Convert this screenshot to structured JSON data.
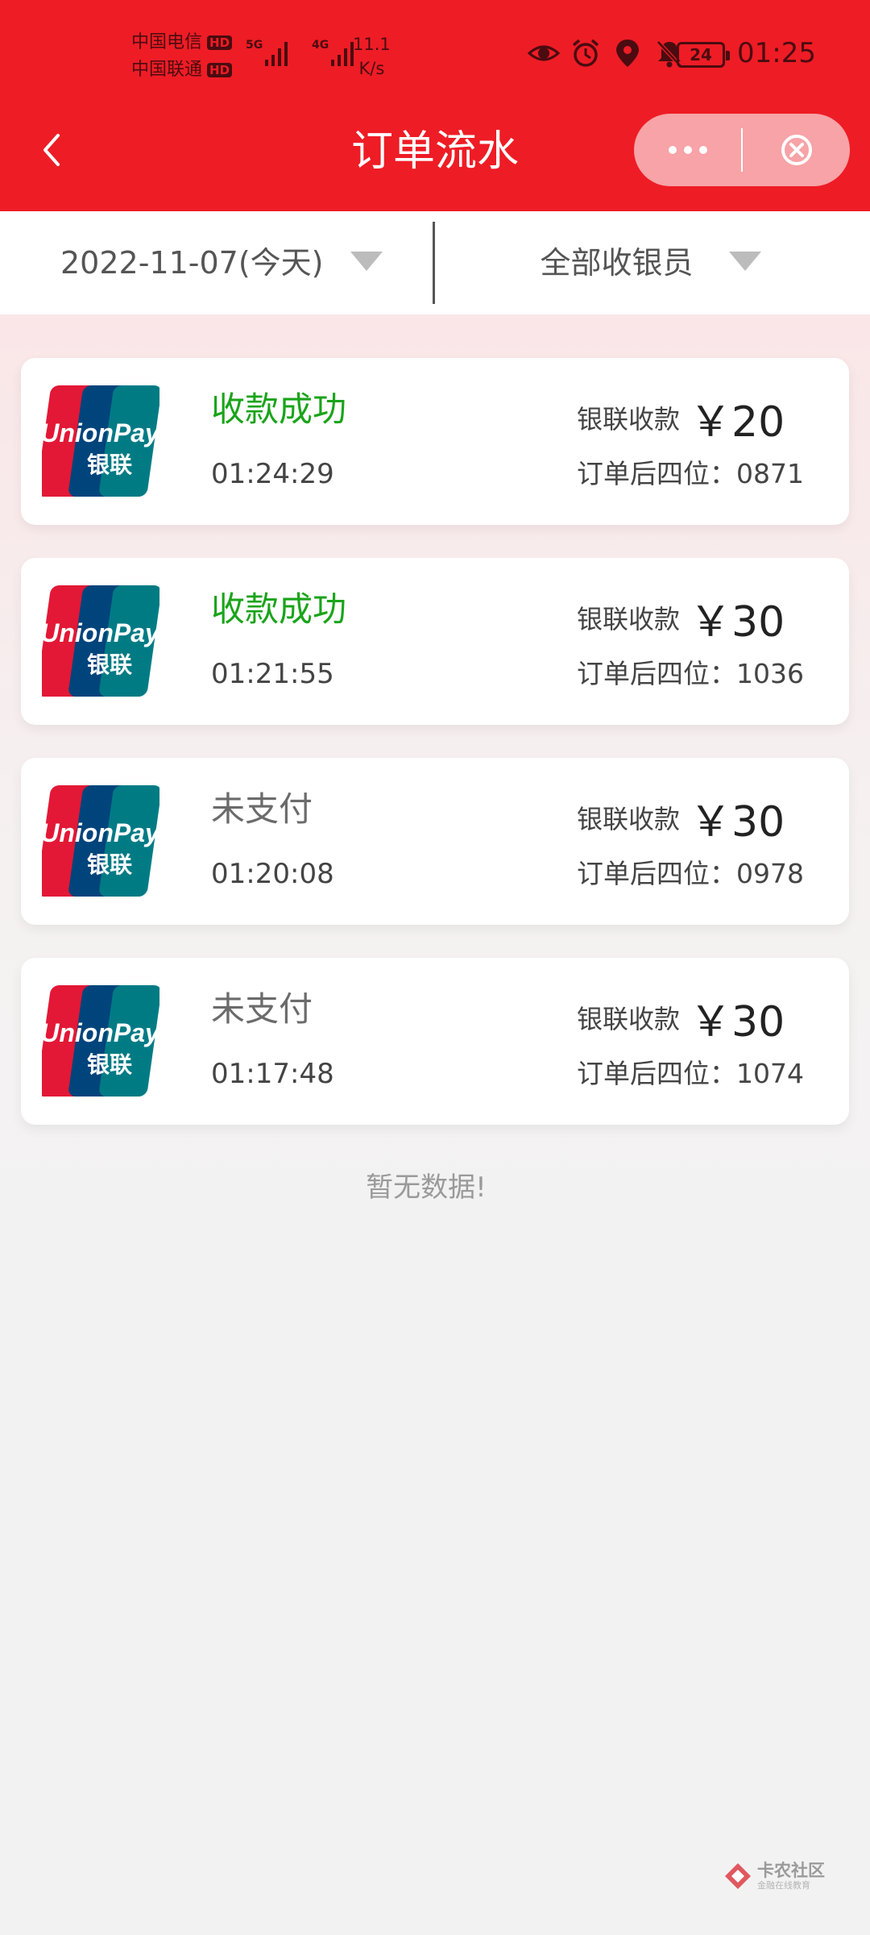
{
  "status_bar": {
    "carriers": [
      "中国电信",
      "中国联通"
    ],
    "hd_badge": "HD",
    "networks": [
      "5G",
      "4G"
    ],
    "speed_value": "11.1",
    "speed_unit": "K/s",
    "battery": "24",
    "time": "01:25"
  },
  "header": {
    "title": "订单流水"
  },
  "filters": {
    "date": "2022-11-07(今天)",
    "cashier": "全部收银员"
  },
  "orders": [
    {
      "status": "收款成功",
      "status_type": "success",
      "time": "01:24:29",
      "pay_label": "银联收款",
      "amount": "￥20",
      "order_label": "订单后四位：",
      "order_suffix": "0871"
    },
    {
      "status": "收款成功",
      "status_type": "success",
      "time": "01:21:55",
      "pay_label": "银联收款",
      "amount": "￥30",
      "order_label": "订单后四位：",
      "order_suffix": "1036"
    },
    {
      "status": "未支付",
      "status_type": "unpaid",
      "time": "01:20:08",
      "pay_label": "银联收款",
      "amount": "￥30",
      "order_label": "订单后四位：",
      "order_suffix": "0978"
    },
    {
      "status": "未支付",
      "status_type": "unpaid",
      "time": "01:17:48",
      "pay_label": "银联收款",
      "amount": "￥30",
      "order_label": "订单后四位：",
      "order_suffix": "1074"
    }
  ],
  "logo_text": {
    "top": "UnionPay",
    "bottom": "银联"
  },
  "no_data": "暂无数据!",
  "watermark": {
    "name": "卡农社区",
    "sub": "金融在线教育"
  },
  "colors": {
    "header_red": "#ee1c25",
    "success_green": "#1aa41a",
    "unpaid_gray": "#6b6b6b"
  }
}
